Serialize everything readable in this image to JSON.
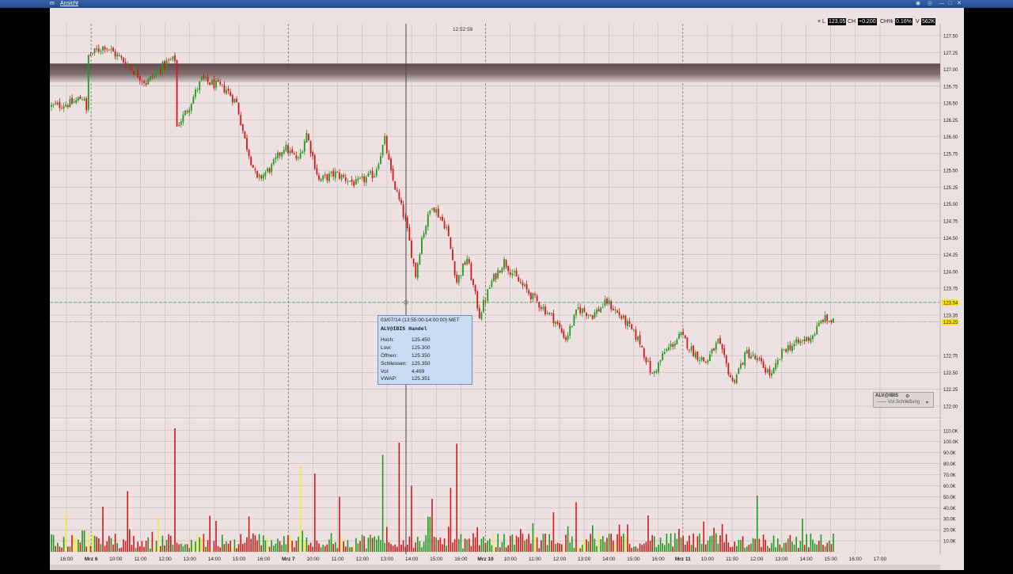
{
  "menu": {
    "left_fragment": "m",
    "view": "Ansicht"
  },
  "crosshair": {
    "time_label": "12:52:59",
    "price_label": "123.54",
    "x_index": 160
  },
  "quote_bar": {
    "l_label": "L",
    "last": "123.05",
    "ch_label": "CH",
    "change": "+0.200",
    "chp_label": "CH%",
    "change_pct": "0.16%",
    "v_label": "V",
    "volume": "562K"
  },
  "tooltip": {
    "header": "03/07/14 (13:55:00-14:00:00) MET",
    "symbol": "ALV@IBIS Handel",
    "rows": [
      {
        "key": "Hoch:",
        "value": "125.450"
      },
      {
        "key": "Low:",
        "value": "125.300"
      },
      {
        "key": "Öffnen:",
        "value": "125.350"
      },
      {
        "key": "Schliessen:",
        "value": "125.350"
      },
      {
        "key": "Vol:",
        "value": "4,499"
      },
      {
        "key": "VWAP:",
        "value": "125.351"
      }
    ]
  },
  "legend_box": {
    "title": "ALV@IBIS",
    "series": "Vor.Schließung"
  },
  "colors": {
    "up": "#1f9a1f",
    "down": "#d01919",
    "neutral_volume": "#f2ec3c",
    "prev_close_line": "#4fb36a",
    "resistance_band": "#6b5353",
    "bg": "#ede1e1",
    "grid": "#c6bcbc"
  },
  "chart_data": {
    "type": "candlestick",
    "price_axis": {
      "ticks": [
        "127.50",
        "127.25",
        "127.00",
        "126.75",
        "126.50",
        "126.25",
        "126.00",
        "125.75",
        "125.50",
        "125.25",
        "125.00",
        "124.75",
        "124.50",
        "124.25",
        "124.00",
        "123.75",
        "123.54",
        "123.35",
        "123.25",
        "122.75",
        "122.50",
        "122.25",
        "122.00"
      ],
      "ylim": [
        122.0,
        127.5
      ],
      "last_price_marker": "123.25",
      "prev_close_marker": "123.54"
    },
    "resistance_band": [
      126.9,
      127.05
    ],
    "volume_axis": {
      "ticks": [
        "110.0K",
        "100.0K",
        "90.0K",
        "80.0K",
        "70.0K",
        "60.0K",
        "50.0K",
        "40.0K",
        "30.0K",
        "20.0K",
        "10.0K"
      ],
      "ylim": [
        0,
        112000
      ]
    },
    "time_axis": [
      {
        "label": "16:00",
        "bold": false
      },
      {
        "label": "Mrz 6",
        "bold": true
      },
      {
        "label": "10:00",
        "bold": false
      },
      {
        "label": "11:00",
        "bold": false
      },
      {
        "label": "12:00",
        "bold": false
      },
      {
        "label": "13:00",
        "bold": false
      },
      {
        "label": "14:00",
        "bold": false
      },
      {
        "label": "15:00",
        "bold": false
      },
      {
        "label": "16:00",
        "bold": false
      },
      {
        "label": "Mrz 7",
        "bold": true
      },
      {
        "label": "10:00",
        "bold": false
      },
      {
        "label": "11:00",
        "bold": false
      },
      {
        "label": "12:00",
        "bold": false
      },
      {
        "label": "13:00",
        "bold": false
      },
      {
        "label": "14:00",
        "bold": false
      },
      {
        "label": "15:00",
        "bold": false
      },
      {
        "label": "16:00",
        "bold": false
      },
      {
        "label": "Mrz 10",
        "bold": true
      },
      {
        "label": "10:00",
        "bold": false
      },
      {
        "label": "11:00",
        "bold": false
      },
      {
        "label": "12:00",
        "bold": false
      },
      {
        "label": "13:00",
        "bold": false
      },
      {
        "label": "14:00",
        "bold": false
      },
      {
        "label": "15:00",
        "bold": false
      },
      {
        "label": "16:00",
        "bold": false
      },
      {
        "label": "Mrz 11",
        "bold": true
      },
      {
        "label": "10:00",
        "bold": false
      },
      {
        "label": "11:00",
        "bold": false
      },
      {
        "label": "12:00",
        "bold": false
      },
      {
        "label": "13:00",
        "bold": false
      },
      {
        "label": "14:00",
        "bold": false
      },
      {
        "label": "15:00",
        "bold": false
      },
      {
        "label": "16:00",
        "bold": false
      },
      {
        "label": "17:00",
        "bold": false
      }
    ],
    "day_separators": [
      "Mrz 6",
      "Mrz 7",
      "Mrz 10",
      "Mrz 11"
    ],
    "close_path": [
      [
        0,
        126.45
      ],
      [
        10,
        126.5
      ],
      [
        16,
        126.6
      ],
      [
        17,
        126.35
      ],
      [
        18,
        127.2
      ],
      [
        26,
        127.35
      ],
      [
        36,
        127.1
      ],
      [
        46,
        126.8
      ],
      [
        56,
        127.1
      ],
      [
        60,
        127.15
      ],
      [
        61,
        126.15
      ],
      [
        66,
        126.4
      ],
      [
        73,
        126.85
      ],
      [
        85,
        126.7
      ],
      [
        90,
        126.5
      ],
      [
        94,
        125.95
      ],
      [
        100,
        125.35
      ],
      [
        107,
        125.55
      ],
      [
        113,
        125.85
      ],
      [
        120,
        125.65
      ],
      [
        124,
        126.05
      ],
      [
        130,
        125.35
      ],
      [
        138,
        125.45
      ],
      [
        148,
        125.3
      ],
      [
        157,
        125.45
      ],
      [
        162,
        125.95
      ],
      [
        165,
        125.45
      ],
      [
        172,
        124.75
      ],
      [
        177,
        123.95
      ],
      [
        180,
        124.5
      ],
      [
        185,
        125.0
      ],
      [
        192,
        124.65
      ],
      [
        197,
        123.85
      ],
      [
        202,
        124.2
      ],
      [
        208,
        123.35
      ],
      [
        214,
        123.85
      ],
      [
        220,
        124.15
      ],
      [
        227,
        123.85
      ],
      [
        236,
        123.55
      ],
      [
        244,
        123.3
      ],
      [
        250,
        123.0
      ],
      [
        256,
        123.45
      ],
      [
        263,
        123.35
      ],
      [
        270,
        123.55
      ],
      [
        279,
        123.25
      ],
      [
        286,
        122.95
      ],
      [
        292,
        122.45
      ],
      [
        298,
        122.8
      ],
      [
        306,
        123.05
      ],
      [
        312,
        122.8
      ],
      [
        318,
        122.65
      ],
      [
        324,
        122.95
      ],
      [
        331,
        122.35
      ],
      [
        338,
        122.8
      ],
      [
        344,
        122.65
      ],
      [
        350,
        122.45
      ],
      [
        356,
        122.85
      ],
      [
        364,
        122.95
      ],
      [
        370,
        123.05
      ],
      [
        375,
        123.3
      ],
      [
        380,
        123.25
      ]
    ],
    "volume_spikes": [
      [
        7,
        35000,
        "yellow"
      ],
      [
        25,
        41000,
        "red"
      ],
      [
        37,
        55000,
        "red"
      ],
      [
        52,
        32000,
        "yellow"
      ],
      [
        60,
        112000,
        "red"
      ],
      [
        80,
        28000,
        "red"
      ],
      [
        96,
        32000,
        "red"
      ],
      [
        121,
        78000,
        "yellow"
      ],
      [
        128,
        71000,
        "red"
      ],
      [
        140,
        50000,
        "red"
      ],
      [
        161,
        88000,
        "green"
      ],
      [
        169,
        99000,
        "red"
      ],
      [
        175,
        60000,
        "red"
      ],
      [
        185,
        48000,
        "red"
      ],
      [
        194,
        58000,
        "red"
      ],
      [
        197,
        98000,
        "red"
      ],
      [
        244,
        36000,
        "red"
      ],
      [
        255,
        45000,
        "red"
      ],
      [
        263,
        24000,
        "green"
      ],
      [
        280,
        25000,
        "red"
      ],
      [
        290,
        33000,
        "red"
      ],
      [
        305,
        21000,
        "red"
      ],
      [
        322,
        22000,
        "red"
      ],
      [
        343,
        51000,
        "green"
      ],
      [
        365,
        30000,
        "green"
      ],
      [
        373,
        10000,
        "red"
      ],
      [
        382,
        6000,
        "green"
      ]
    ]
  }
}
